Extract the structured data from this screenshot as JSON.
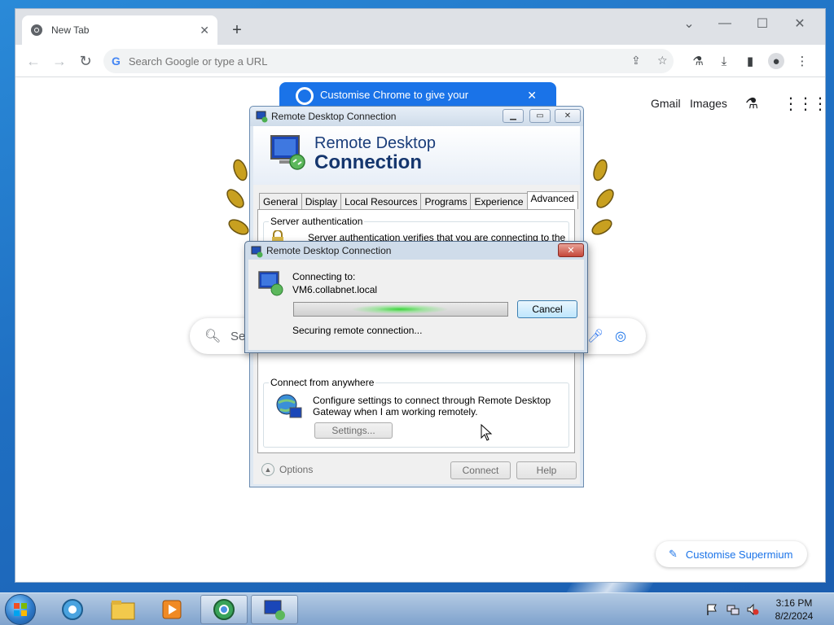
{
  "browser": {
    "tab_title": "New Tab",
    "omnibox_placeholder": "Search Google or type a URL",
    "ntp": {
      "gmail": "Gmail",
      "images": "Images",
      "promo_text": "Customise Chrome to give your",
      "search_placeholder": "Se",
      "customise_button": "Customise Supermium"
    }
  },
  "rdc_window": {
    "title": "Remote Desktop Connection",
    "banner_line1": "Remote Desktop",
    "banner_line2": "Connection",
    "tabs": [
      "General",
      "Display",
      "Local Resources",
      "Programs",
      "Experience",
      "Advanced"
    ],
    "active_tab": "Advanced",
    "server_auth": {
      "label": "Server authentication",
      "text": "Server authentication verifies that you are connecting to the"
    },
    "connect_anywhere": {
      "label": "Connect from anywhere",
      "text_line1": "Configure settings to connect through Remote Desktop",
      "text_line2": "Gateway when I am working remotely.",
      "settings_button": "Settings..."
    },
    "options_label": "Options",
    "connect_button": "Connect",
    "help_button": "Help"
  },
  "connecting_dialog": {
    "title": "Remote Desktop Connection",
    "connecting_to_label": "Connecting to:",
    "host": "VM6.collabnet.local",
    "status": "Securing remote connection...",
    "cancel_button": "Cancel"
  },
  "taskbar": {
    "time": "3:16 PM",
    "date": "8/2/2024"
  }
}
